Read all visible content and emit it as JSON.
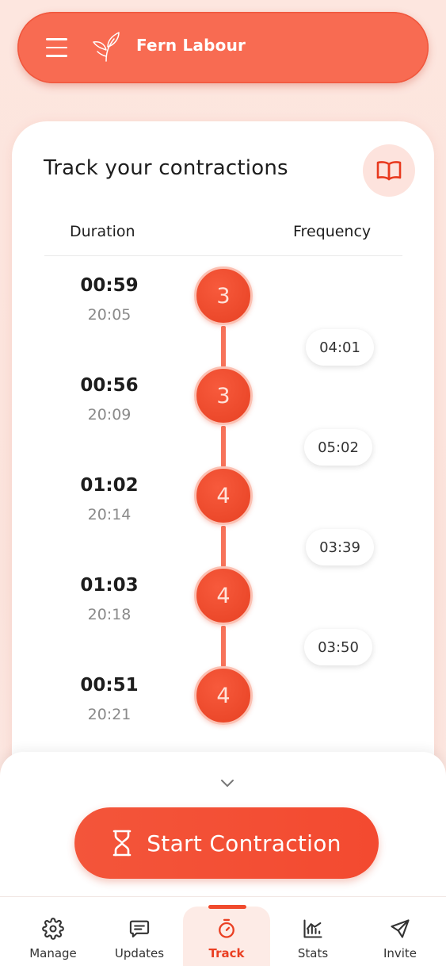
{
  "header": {
    "app_name": "Fern Labour",
    "menu_icon": "hamburger-menu-icon",
    "logo_icon": "leaf-logo-icon",
    "accent_color": "#f86b52"
  },
  "tracker": {
    "title": "Track your contractions",
    "guide_icon": "book-icon",
    "columns": {
      "duration": "Duration",
      "frequency": "Frequency"
    },
    "contractions": [
      {
        "duration": "00:59",
        "start_time": "20:05",
        "intensity": "3"
      },
      {
        "duration": "00:56",
        "start_time": "20:09",
        "intensity": "3"
      },
      {
        "duration": "01:02",
        "start_time": "20:14",
        "intensity": "4"
      },
      {
        "duration": "01:03",
        "start_time": "20:18",
        "intensity": "4"
      },
      {
        "duration": "00:51",
        "start_time": "20:21",
        "intensity": "4"
      }
    ],
    "frequencies": [
      "04:01",
      "05:02",
      "03:39",
      "03:50"
    ]
  },
  "sheet": {
    "collapse_icon": "chevron-down-icon",
    "start_button_label": "Start Contraction",
    "start_button_icon": "hourglass-icon",
    "button_color": "#f34a30"
  },
  "nav": {
    "items": [
      {
        "label": "Manage",
        "icon": "gear-icon"
      },
      {
        "label": "Updates",
        "icon": "message-icon"
      },
      {
        "label": "Track",
        "icon": "stopwatch-icon",
        "active": true
      },
      {
        "label": "Stats",
        "icon": "chart-icon"
      },
      {
        "label": "Invite",
        "icon": "send-icon"
      }
    ],
    "active_color": "#ea3f22"
  }
}
